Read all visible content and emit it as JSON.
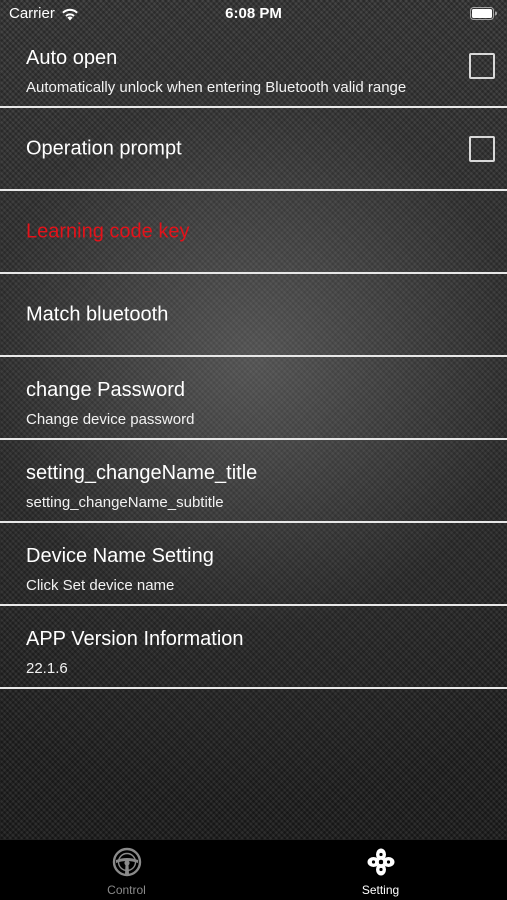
{
  "status_bar": {
    "carrier": "Carrier",
    "time": "6:08 PM"
  },
  "settings": {
    "auto_open": {
      "title": "Auto open",
      "subtitle": "Automatically unlock when entering Bluetooth valid range",
      "checked": false
    },
    "operation_prompt": {
      "title": "Operation prompt",
      "checked": false
    },
    "learning_code_key": {
      "title": "Learning code key",
      "color": "#e3121a"
    },
    "match_bluetooth": {
      "title": "Match bluetooth"
    },
    "change_password": {
      "title": "change Password",
      "subtitle": "Change device password"
    },
    "change_name": {
      "title": "setting_changeName_title",
      "subtitle": "setting_changeName_subtitle"
    },
    "device_name": {
      "title": "Device Name Setting",
      "subtitle": "Click Set device name"
    },
    "app_version": {
      "title": "APP Version Information",
      "subtitle": "22.1.6"
    }
  },
  "tab_bar": {
    "tabs": [
      {
        "label": "Control",
        "icon": "steering-wheel-icon",
        "active": false
      },
      {
        "label": "Setting",
        "icon": "setting-icon",
        "active": true
      }
    ]
  }
}
